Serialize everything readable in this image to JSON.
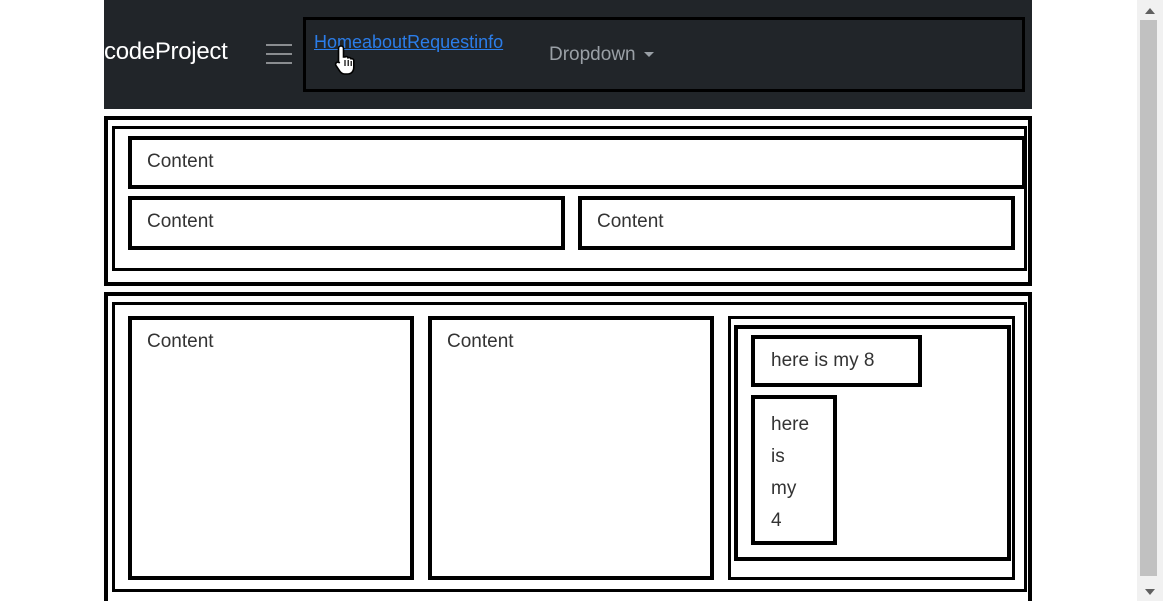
{
  "navbar": {
    "brand": "codeProject",
    "links": [
      {
        "label": "Home"
      },
      {
        "label": "about"
      },
      {
        "label": "Request"
      },
      {
        "label": "info"
      }
    ],
    "dropdown_label": "Dropdown"
  },
  "row1": {
    "full_content": "Content",
    "half_left": "Content",
    "half_right": "Content"
  },
  "row2": {
    "col1": "Content",
    "col2": "Content",
    "nested_8": "here is my 8",
    "nested_4_words": [
      "here",
      "is",
      "my",
      "4"
    ]
  },
  "colors": {
    "navbar_bg": "#212529",
    "link": "#2b7de9",
    "border": "#000000"
  }
}
